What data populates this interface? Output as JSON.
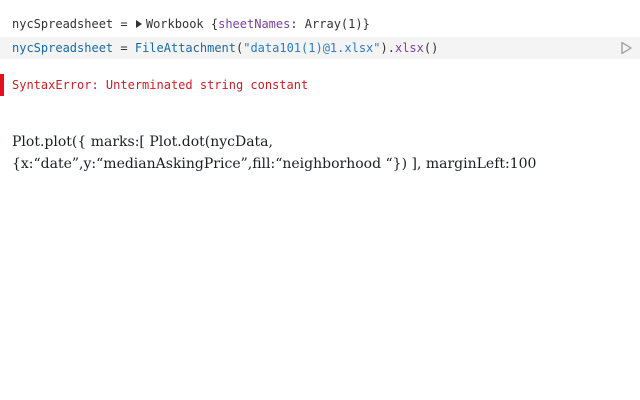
{
  "output_cell": {
    "variable": "nycSpreadsheet",
    "equals": " = ",
    "type_name": "Workbook",
    "brace_open": " {",
    "prop_name": "sheetNames",
    "prop_value": ": Array(1)}"
  },
  "code_cell": {
    "variable": "nycSpreadsheet",
    "equals": " = ",
    "function": "FileAttachment",
    "paren_open": "(",
    "string": "\"data101(1)@1.xlsx\"",
    "paren_close": ").",
    "method": "xlsx",
    "call": "()"
  },
  "error": {
    "message": "SyntaxError: Unterminated string constant",
    "color": "#e0121f"
  },
  "prose": {
    "line1": "Plot.plot({ marks:[ Plot.dot(nycData,",
    "line2": "{x:“date”,y:“medianAskingPrice”,fill:“neighborhood “}) ], marginLeft:100"
  },
  "icons": {
    "disclosure": "triangle-right-icon",
    "run": "play-icon"
  }
}
